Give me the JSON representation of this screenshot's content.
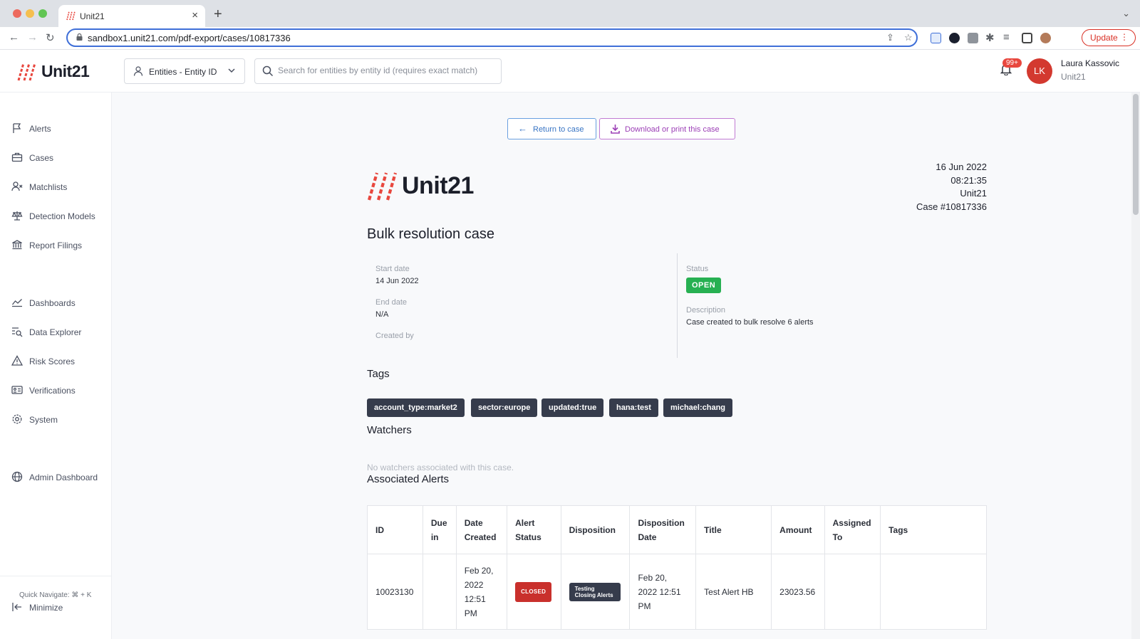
{
  "browser": {
    "tab_title": "Unit21",
    "url": "sandbox1.unit21.com/pdf-export/cases/10817336",
    "update_label": "Update"
  },
  "header": {
    "logo_text": "Unit21",
    "entity_selector": "Entities - Entity ID",
    "search_placeholder": "Search for entities by entity id (requires exact match)",
    "notification_count": "99+",
    "user": {
      "initials": "LK",
      "name": "Laura Kassovic",
      "org": "Unit21"
    }
  },
  "sidebar": {
    "items": [
      {
        "label": "Alerts",
        "icon": "flag-icon"
      },
      {
        "label": "Cases",
        "icon": "briefcase-icon"
      },
      {
        "label": "Matchlists",
        "icon": "person-x-icon"
      },
      {
        "label": "Detection Models",
        "icon": "scale-icon"
      },
      {
        "label": "Report Filings",
        "icon": "bank-icon"
      },
      {
        "label": "Dashboards",
        "icon": "line-chart-icon"
      },
      {
        "label": "Data Explorer",
        "icon": "list-search-icon"
      },
      {
        "label": "Risk Scores",
        "icon": "warning-icon"
      },
      {
        "label": "Verifications",
        "icon": "id-card-icon"
      },
      {
        "label": "System",
        "icon": "gear-icon"
      },
      {
        "label": "Admin Dashboard",
        "icon": "globe-icon"
      }
    ],
    "quick_navigate": "Quick Navigate: ⌘ + K",
    "minimize_label": "Minimize"
  },
  "actions": {
    "return_label": "Return to case",
    "download_label": "Download or print this case"
  },
  "doc": {
    "logo_text": "Unit21",
    "meta": {
      "date": "16 Jun 2022",
      "time": "08:21:35",
      "org": "Unit21",
      "case_number": "Case #10817336"
    },
    "title": "Bulk resolution case",
    "start_date_label": "Start date",
    "start_date": "14 Jun 2022",
    "end_date_label": "End date",
    "end_date": "N/A",
    "created_by_label": "Created by",
    "status_label": "Status",
    "status": "OPEN",
    "description_label": "Description",
    "description": "Case created to bulk resolve 6 alerts",
    "tags_title": "Tags",
    "tags": [
      "account_type:market2",
      "sector:europe",
      "updated:true",
      "hana:test",
      "michael:chang"
    ],
    "watchers_title": "Watchers",
    "watchers_empty": "No watchers associated with this case.",
    "alerts_title": "Associated Alerts"
  },
  "alerts_table": {
    "headers": [
      "ID",
      "Due in",
      "Date Created",
      "Alert Status",
      "Disposition",
      "Disposition Date",
      "Title",
      "Amount",
      "Assigned To",
      "Tags"
    ],
    "rows": [
      {
        "id": "10023130",
        "due_in": "",
        "date_created": "Feb 20, 2022 12:51 PM",
        "alert_status": "CLOSED",
        "disposition": "Testing Closing Alerts",
        "disposition_date": "Feb 20, 2022 12:51 PM",
        "title": "Test Alert HB",
        "amount": "23023.56",
        "assigned_to": "",
        "tags": ""
      }
    ]
  },
  "colors": {
    "accent_blue": "#3975c4",
    "accent_purple": "#9c3fb6",
    "status_open": "#27b052",
    "status_closed": "#c9302c",
    "tag_bg": "#363c4c",
    "brand_red": "#e8473e"
  }
}
